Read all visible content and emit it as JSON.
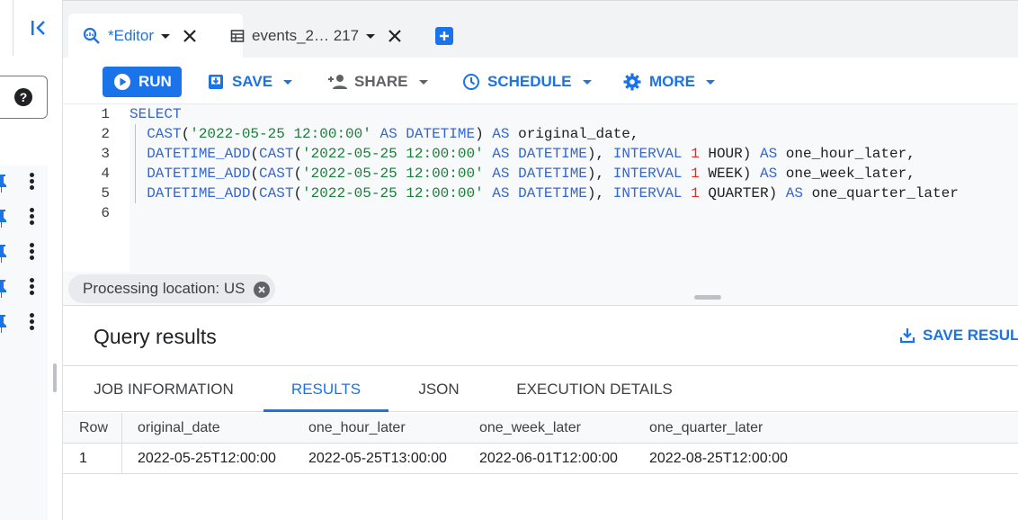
{
  "tabs": [
    {
      "label": "*Editor",
      "active": true
    },
    {
      "label": "events_2… 217",
      "active": false
    }
  ],
  "toolbar": {
    "run": "RUN",
    "save": "SAVE",
    "share": "SHARE",
    "schedule": "SCHEDULE",
    "more": "MORE"
  },
  "editor": {
    "line_numbers": [
      "1",
      "2",
      "3",
      "4",
      "5",
      "6"
    ]
  },
  "processing": {
    "label": "Processing location: US"
  },
  "results": {
    "title": "Query results",
    "save_results": "SAVE RESULTS",
    "tabs": [
      "JOB INFORMATION",
      "RESULTS",
      "JSON",
      "EXECUTION DETAILS"
    ],
    "active_tab": "RESULTS",
    "columns": [
      "Row",
      "original_date",
      "one_hour_later",
      "one_week_later",
      "one_quarter_later"
    ],
    "rows": [
      [
        "1",
        "2022-05-25T12:00:00",
        "2022-05-25T13:00:00",
        "2022-06-01T12:00:00",
        "2022-08-25T12:00:00"
      ]
    ]
  },
  "colors": {
    "accent": "#1a73e8",
    "keyword": "#3367d6",
    "string": "#188038",
    "number": "#d93025"
  },
  "icons": [
    "collapse-panel-icon",
    "help-icon",
    "pin-icon",
    "more-vert-icon",
    "query-icon",
    "table-icon",
    "close-icon",
    "add-tab-icon",
    "play-icon",
    "save-icon",
    "person-add-icon",
    "clock-icon",
    "gear-icon",
    "download-icon"
  ]
}
